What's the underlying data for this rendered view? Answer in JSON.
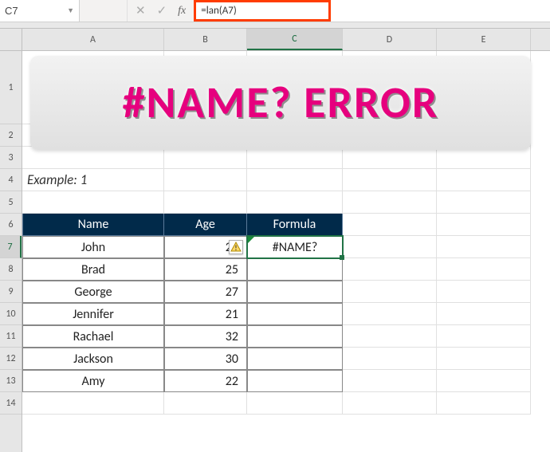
{
  "formula_bar": {
    "cell_ref": "C7",
    "formula": "=lan(A7)",
    "cancel_icon": "✕",
    "confirm_icon": "✓",
    "fx_label": "fx",
    "dropdown_icon": "▼"
  },
  "columns": [
    "A",
    "B",
    "C",
    "D",
    "E"
  ],
  "rows": [
    "1",
    "2",
    "3",
    "4",
    "5",
    "6",
    "7",
    "8",
    "9",
    "10",
    "11",
    "12",
    "13",
    "14"
  ],
  "banner_text": "#NAME? ERROR",
  "example_label": "Example: 1",
  "table": {
    "headers": {
      "name": "Name",
      "age": "Age",
      "formula": "Formula"
    },
    "rows": [
      {
        "name": "John",
        "age": "20",
        "formula": "#NAME?"
      },
      {
        "name": "Brad",
        "age": "25",
        "formula": ""
      },
      {
        "name": "George",
        "age": "27",
        "formula": ""
      },
      {
        "name": "Jennifer",
        "age": "21",
        "formula": ""
      },
      {
        "name": "Rachael",
        "age": "32",
        "formula": ""
      },
      {
        "name": "Jackson",
        "age": "30",
        "formula": ""
      },
      {
        "name": "Amy",
        "age": "22",
        "formula": ""
      }
    ]
  },
  "selected": {
    "row": "7",
    "col": "C"
  }
}
